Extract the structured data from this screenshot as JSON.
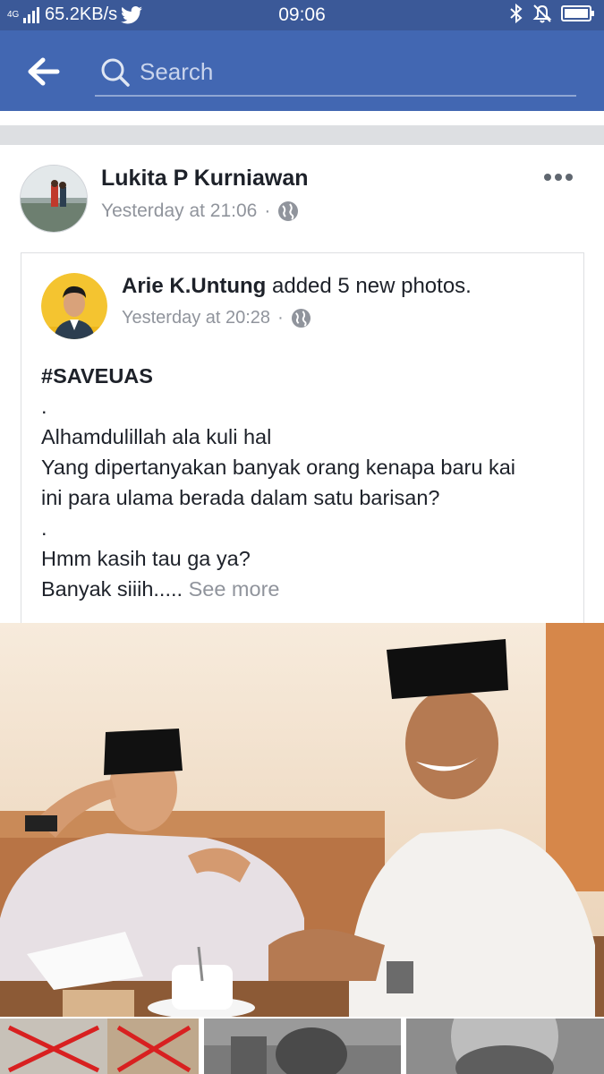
{
  "status_bar": {
    "network_type": "4G",
    "speed": "65.2KB/s",
    "time": "09:06",
    "icons": [
      "signal-icon",
      "twitter-icon",
      "bluetooth-icon",
      "mute-icon",
      "battery-icon"
    ]
  },
  "app_bar": {
    "search_placeholder": "Search",
    "icons": [
      "back-arrow-icon",
      "search-icon"
    ]
  },
  "post": {
    "author": "Lukita P Kurniawan",
    "timestamp": "Yesterday at 21:06",
    "privacy_icon": "globe-icon",
    "more_icon": "more-dots-icon",
    "shared": {
      "author": "Arie K.Untung",
      "action": " added 5 new photos.",
      "timestamp": "Yesterday at 20:28",
      "privacy_icon": "globe-icon",
      "text": {
        "hashtag": "#SAVEUAS",
        "line1": ".",
        "line2": "Alhamdulillah ala kuli hal",
        "line3": "Yang dipertanyakan banyak orang kenapa baru kai",
        "line4": "ini para ulama berada dalam satu barisan?",
        "line5": ".",
        "line6": "Hmm kasih tau ga ya?",
        "line7": "Banyak siiih..... ",
        "see_more": "See more"
      }
    }
  },
  "colors": {
    "facebook_blue": "#4267b2",
    "status_blue": "#3b5998",
    "meta_grey": "#90949c",
    "separator": "#dddfe2"
  }
}
